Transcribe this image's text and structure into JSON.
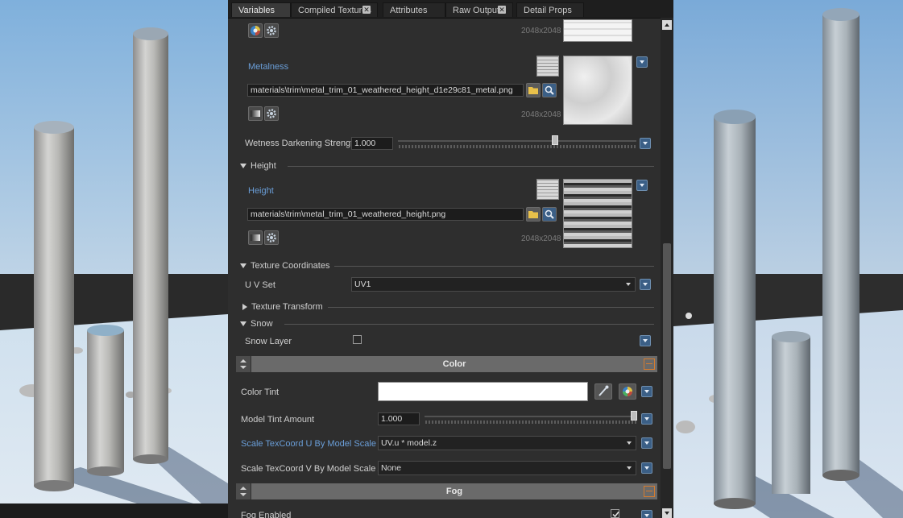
{
  "tabs": [
    {
      "label": "Variables",
      "active": true,
      "closable": false
    },
    {
      "label": "Compiled Textures",
      "active": false,
      "closable": true
    },
    {
      "label": "Attributes",
      "active": false,
      "closable": false
    },
    {
      "label": "Raw Output",
      "active": false,
      "closable": true
    },
    {
      "label": "Detail Props",
      "active": false,
      "closable": false
    }
  ],
  "top_texture": {
    "resolution": "2048x2048"
  },
  "metalness": {
    "label": "Metalness",
    "path": "materials\\trim\\metal_trim_01_weathered_height_d1e29c81_metal.png",
    "resolution": "2048x2048"
  },
  "wetness": {
    "label": "Wetness Darkening Strength",
    "value": "1.000",
    "slider_fraction": 0.66
  },
  "height_section": {
    "title": "Height"
  },
  "height": {
    "label": "Height",
    "path": "materials\\trim\\metal_trim_01_weathered_height.png",
    "resolution": "2048x2048"
  },
  "texcoord_section": {
    "title": "Texture Coordinates"
  },
  "uvset": {
    "label": "U V Set",
    "value": "UV1"
  },
  "texture_transform": {
    "title": "Texture Transform"
  },
  "snow_section": {
    "title": "Snow"
  },
  "snow_layer": {
    "label": "Snow Layer",
    "checked": false
  },
  "color_group": {
    "title": "Color"
  },
  "color_tint": {
    "label": "Color Tint",
    "value_hex": "#ffffff"
  },
  "model_tint": {
    "label": "Model Tint Amount",
    "value": "1.000",
    "slider_fraction": 1.0
  },
  "scale_u": {
    "label": "Scale TexCoord U By Model Scale Axis",
    "value": "UV.u * model.z"
  },
  "scale_v": {
    "label": "Scale TexCoord V By Model Scale Axis",
    "value": "None"
  },
  "fog_group": {
    "title": "Fog"
  },
  "fog_enabled": {
    "label": "Fog Enabled",
    "checked": true
  },
  "colors": {
    "accent": "#3b5f86",
    "link": "#6a9ed8",
    "group_collapse": "#d47b2f"
  }
}
